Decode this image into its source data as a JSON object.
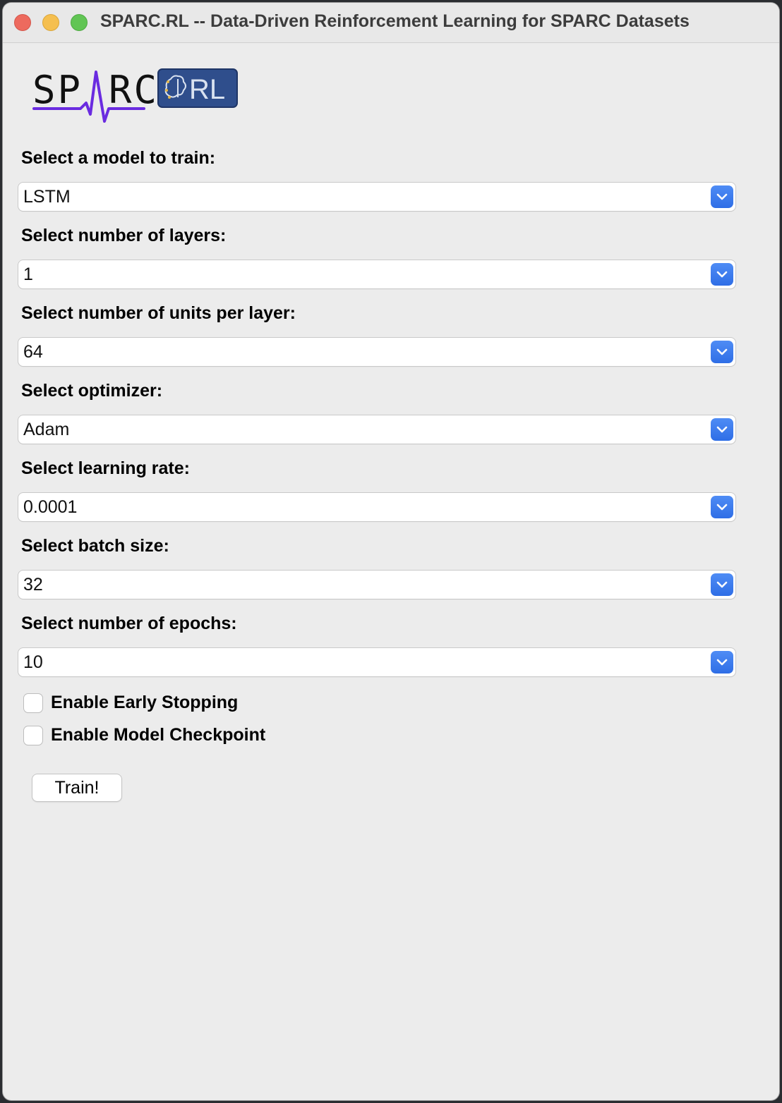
{
  "window": {
    "title": "SPARC.RL -- Data-Driven Reinforcement Learning for SPARC Datasets"
  },
  "logo": {
    "text_main": "SPARC",
    "text_badge": "RL",
    "colors": {
      "wordmark": "#111111",
      "pulse": "#6a2be0",
      "badge_bg": "#2f4e8c",
      "badge_text": "#d9e2f0"
    }
  },
  "form": {
    "fields": [
      {
        "label": "Select a model to train:",
        "value": "LSTM"
      },
      {
        "label": "Select number of layers:",
        "value": "1"
      },
      {
        "label": "Select number of units per layer:",
        "value": "64"
      },
      {
        "label": "Select optimizer:",
        "value": "Adam"
      },
      {
        "label": "Select learning rate:",
        "value": "0.0001"
      },
      {
        "label": "Select batch size:",
        "value": "32"
      },
      {
        "label": "Select number of epochs:",
        "value": "10"
      }
    ],
    "checkboxes": [
      {
        "label": "Enable Early Stopping",
        "checked": false
      },
      {
        "label": "Enable Model Checkpoint",
        "checked": false
      }
    ],
    "train_button": "Train!"
  },
  "colors": {
    "window_bg": "#ececec",
    "accent": "#3478f6",
    "close": "#ed6a5e",
    "minimize": "#f5bf4f",
    "maximize": "#61c554"
  }
}
